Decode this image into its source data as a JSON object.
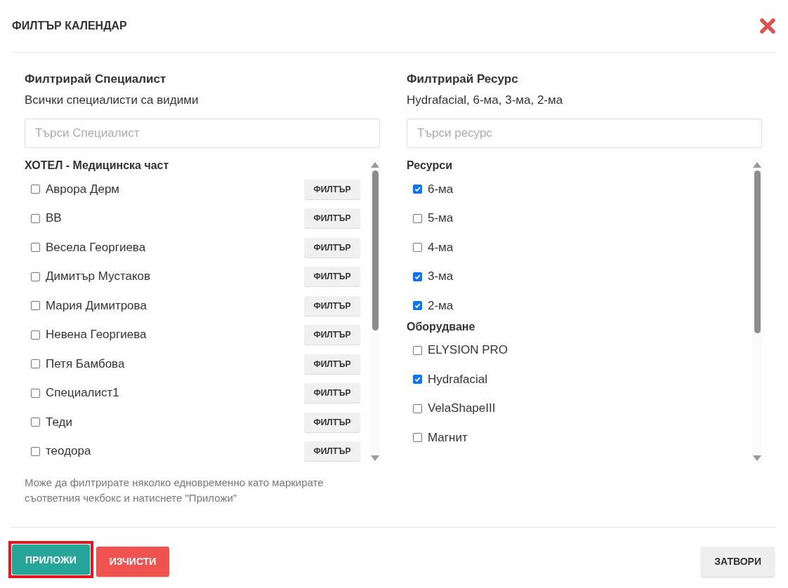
{
  "dialog": {
    "title": "ФИЛТЪР КАЛЕНДАР"
  },
  "specialist_filter": {
    "heading": "Филтрирай Специалист",
    "summary": "Всички специалисти са видими",
    "search": {
      "placeholder": "Търси Специалист"
    },
    "groups": [
      {
        "name": "ХОТЕЛ - Медицинска част",
        "items": [
          {
            "label": "Аврора Дерм",
            "checked": false,
            "button": "ФИЛТЪР"
          },
          {
            "label": "ВВ",
            "checked": false,
            "button": "ФИЛТЪР"
          },
          {
            "label": "Весела Георгиева",
            "checked": false,
            "button": "ФИЛТЪР"
          },
          {
            "label": "Димитър Мустаков",
            "checked": false,
            "button": "ФИЛТЪР"
          },
          {
            "label": "Мария Димитрова",
            "checked": false,
            "button": "ФИЛТЪР"
          },
          {
            "label": "Невена Георгиева",
            "checked": false,
            "button": "ФИЛТЪР"
          },
          {
            "label": "Петя Бамбова",
            "checked": false,
            "button": "ФИЛТЪР"
          },
          {
            "label": "Специалист1",
            "checked": false,
            "button": "ФИЛТЪР"
          },
          {
            "label": "Теди",
            "checked": false,
            "button": "ФИЛТЪР"
          },
          {
            "label": "теодора",
            "checked": false,
            "button": "ФИЛТЪР"
          }
        ]
      }
    ]
  },
  "resource_filter": {
    "heading": "Филтрирай Ресурс",
    "summary": "Hydrafacial, 6-ма, 3-ма, 2-ма",
    "search": {
      "placeholder": "Търси ресурс"
    },
    "groups": [
      {
        "name": "Ресурси",
        "items": [
          {
            "label": "6-ма",
            "checked": true
          },
          {
            "label": "5-ма",
            "checked": false
          },
          {
            "label": "4-ма",
            "checked": false
          },
          {
            "label": "3-ма",
            "checked": true
          },
          {
            "label": "2-ма",
            "checked": true
          }
        ]
      },
      {
        "name": "Оборудване",
        "items": [
          {
            "label": "ELYSION PRO",
            "checked": false
          },
          {
            "label": "Hydrafacial",
            "checked": true
          },
          {
            "label": "VelaShapeIII",
            "checked": false
          },
          {
            "label": "Магнит",
            "checked": false
          }
        ]
      }
    ]
  },
  "hint": "Може да филтрирате няколко едновременно като маркирате съответния чекбокс и натиснете \"Приложи\"",
  "buttons": [
    {
      "label": "ПРИЛОЖИ",
      "kind": "apply",
      "highlighted": true
    },
    {
      "label": "ИЗЧИСТИ",
      "kind": "clear",
      "highlighted": false
    },
    {
      "label": "ЗАТВОРИ",
      "kind": "close",
      "highlighted": false
    }
  ]
}
